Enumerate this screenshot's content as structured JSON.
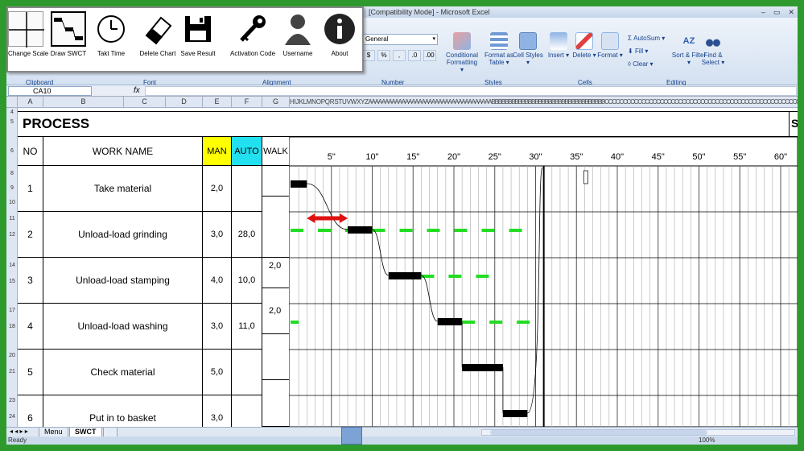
{
  "window": {
    "title": "[Compatibility Mode] - Microsoft Excel",
    "minimize": "‒",
    "restore": "▭",
    "close": "✕"
  },
  "addin_toolbar": {
    "buttons": [
      {
        "label": "Change Scale",
        "icon": "grid-cross-icon"
      },
      {
        "label": "Draw SWCT",
        "icon": "step-chart-icon"
      },
      {
        "label": "Takt Time",
        "icon": "clock-icon"
      },
      {
        "label": "Delete Chart",
        "icon": "eraser-icon"
      },
      {
        "label": "Save Result",
        "icon": "floppy-disk-icon"
      },
      {
        "label": "Activation Code",
        "icon": "key-icon"
      },
      {
        "label": "Username",
        "icon": "user-icon"
      },
      {
        "label": "About",
        "icon": "info-icon"
      }
    ]
  },
  "ribbon": {
    "number_format": "General",
    "number_buttons": [
      "$",
      "%",
      ",",
      ".0",
      ".00"
    ],
    "groups": [
      "Clipboard",
      "Font",
      "Alignment",
      "Number",
      "Styles",
      "Cells",
      "Editing"
    ],
    "styles": [
      "Conditional Formatting ▾",
      "Format as Table ▾",
      "Cell Styles ▾"
    ],
    "cells": [
      "Insert ▾",
      "Delete ▾",
      "Format ▾"
    ],
    "editing": {
      "autosum": "AutoSum ▾",
      "fill": "Fill ▾",
      "clear": "Clear ▾",
      "sort": "Sort & Filter ▾",
      "find": "Find & Select ▾"
    },
    "colors": {
      "ribbon_text": "#15428b"
    }
  },
  "formula_bar": {
    "name_box": "CA10",
    "fx": "fx",
    "value": ""
  },
  "columns": [
    "A",
    "B",
    "C",
    "D",
    "E",
    "F",
    "G"
  ],
  "narrow_columns": "H I J K L M N O P Q R S T U V W X Y Z AAAAAAAAAAAAAAAAAAAAAAAAAAAAAAAAAAAAABBBBBBBBBBBBBBBBBBBBBBBBBBBBBBBBBBCCCCCCCCCCCCCCCCCCCCCCCCCCCCCCCCCCCCCCCCCCCCCCCCCCCCCCCCCCCCCCCC",
  "row_numbers": [
    "4",
    "5",
    "6",
    "8",
    "9",
    "10",
    "11",
    "12",
    "14",
    "15",
    "17",
    "18",
    "20",
    "21",
    "23",
    "24"
  ],
  "sheet": {
    "title": "PROCESS",
    "title_right": "S",
    "headers": {
      "no": "NO",
      "work_name": "WORK NAME",
      "man": "MAN",
      "auto": "AUTO",
      "walk": "WALK"
    },
    "rows": [
      {
        "no": "1",
        "name": "Take material",
        "man": "2,0",
        "auto": ""
      },
      {
        "no": "2",
        "name": "Unload-load grinding",
        "man": "3,0",
        "auto": "28,0"
      },
      {
        "no": "3",
        "name": "Unload-load stamping",
        "man": "4,0",
        "auto": "10,0"
      },
      {
        "no": "4",
        "name": "Unload-load washing",
        "man": "3,0",
        "auto": "11,0"
      },
      {
        "no": "5",
        "name": "Check material",
        "man": "5,0",
        "auto": ""
      },
      {
        "no": "6",
        "name": "Put in to basket",
        "man": "3,0",
        "auto": ""
      }
    ],
    "walk_values": [
      "2,0",
      "2,0"
    ],
    "colors": {
      "man": "#ffff00",
      "auto": "#22e0f0"
    }
  },
  "chart_data": {
    "type": "table",
    "time_ticks": [
      "5\"",
      "10\"",
      "15\"",
      "20\"",
      "25\"",
      "30\"",
      "35\"",
      "40\"",
      "45\"",
      "50\"",
      "55\"",
      "60\""
    ],
    "tick_values": [
      5,
      10,
      15,
      20,
      25,
      30,
      35,
      40,
      45,
      50,
      55,
      60
    ],
    "takt_time": 31,
    "manual_segments": [
      {
        "row": 1,
        "start": 0,
        "end": 2
      },
      {
        "row": 2,
        "start": 7,
        "end": 10
      },
      {
        "row": 3,
        "start": 12,
        "end": 16
      },
      {
        "row": 4,
        "start": 18,
        "end": 21
      },
      {
        "row": 5,
        "start": 21,
        "end": 26
      },
      {
        "row": 6,
        "start": 26,
        "end": 29
      }
    ],
    "auto_segments": [
      {
        "row": 2,
        "start": 0,
        "end": 7
      },
      {
        "row": 2,
        "start": 10,
        "end": 30
      },
      {
        "row": 3,
        "start": 16,
        "end": 26
      },
      {
        "row": 4,
        "start": 0,
        "end": 1
      },
      {
        "row": 4,
        "start": 21,
        "end": 30
      }
    ],
    "walk_arrow": {
      "row": 2,
      "start": 2,
      "end": 7
    },
    "colors": {
      "manual": "#000000",
      "auto": "#22dd22",
      "walk": "#e01010",
      "takt": "#000000"
    }
  },
  "sheet_tabs": {
    "nav": "◂ ◂ ▸ ▸",
    "tabs": [
      "Menu",
      "SWCT"
    ],
    "active": "SWCT"
  },
  "status": {
    "ready": "Ready",
    "zoom": "100%"
  }
}
